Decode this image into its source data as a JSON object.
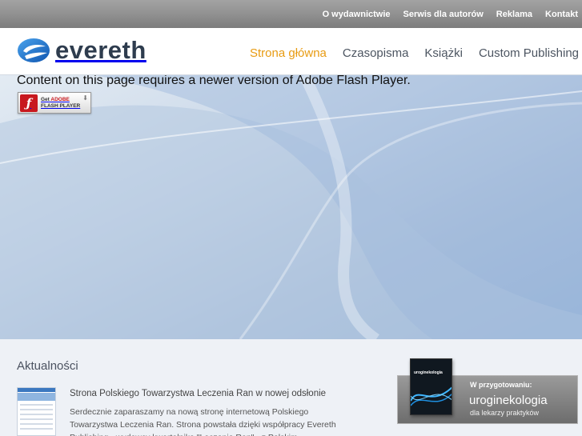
{
  "topnav": {
    "items": [
      "O wydawnictwie",
      "Serwis dla autorów",
      "Reklama",
      "Kontakt"
    ]
  },
  "header": {
    "logo_text": "evereth",
    "nav": [
      "Strona główna",
      "Czasopisma",
      "Książki",
      "Custom Publishing"
    ],
    "active_nav": "Strona główna"
  },
  "hero": {
    "flash_message": "Content on this page requires a newer version of Adobe Flash Player.",
    "flash_button": {
      "line1_prefix": "Get",
      "line1_brand": "ADOBE",
      "line2": "FLASH PLAYER"
    }
  },
  "news": {
    "title": "Aktualności",
    "item_title": "Strona Polskiego Towarzystwa Leczenia Ran w nowej odsłonie",
    "item_body": "Serdecznie zaparaszamy na nową stronę internetową Polskiego Towarzystwa Leczenia Ran. Strona powstała dzięki współpracy Evereth Publishing - wydawcy kwartalnika \"Leczenie Ran\" - z Polskim"
  },
  "promo": {
    "label": "W przygotowaniu:",
    "title": "uroginekologia",
    "subtitle": "dla lekarzy praktyków",
    "book_title": "uroginekologia"
  },
  "colors": {
    "accent": "#e89b12",
    "topbar": "#8f8f8f",
    "nav_text": "#4c5561",
    "logo_blue": "#1f6fc6"
  },
  "icons": [
    "evereth-logo-icon",
    "flash-icon",
    "download-arrow-icon"
  ]
}
